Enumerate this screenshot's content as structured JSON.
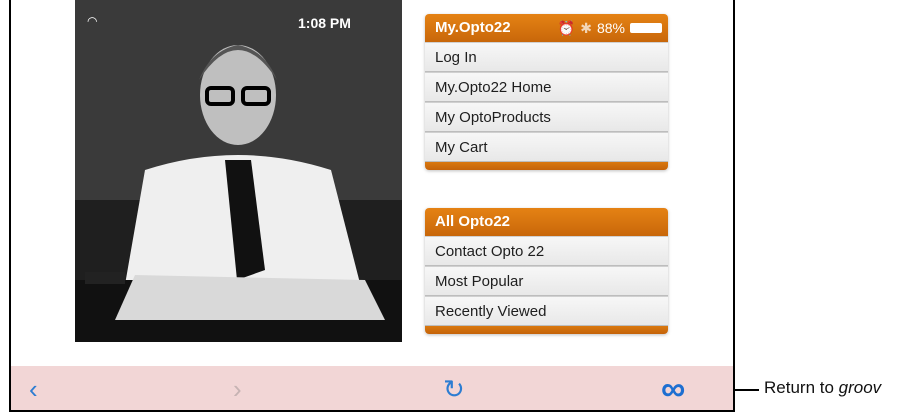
{
  "status": {
    "time": "1:08 PM",
    "battery": "88%"
  },
  "menu1": {
    "title": "My.Opto22",
    "items": [
      {
        "label": "Log In"
      },
      {
        "label": "My.Opto22 Home"
      },
      {
        "label": "My OptoProducts"
      },
      {
        "label": "My Cart"
      }
    ]
  },
  "menu2": {
    "title": "All Opto22",
    "items": [
      {
        "label": "Contact Opto 22"
      },
      {
        "label": "Most Popular"
      },
      {
        "label": "Recently Viewed"
      }
    ]
  },
  "toolbar": {
    "back": "‹",
    "forward": "›",
    "reload": "↻",
    "groov": "∞"
  },
  "callout": {
    "prefix": "Return to ",
    "emphasis": "groov"
  },
  "icons": [
    "wifi-icon",
    "alarm-icon",
    "bluetooth-icon",
    "battery-icon",
    "back-icon",
    "forward-icon",
    "reload-icon",
    "groov-icon"
  ]
}
